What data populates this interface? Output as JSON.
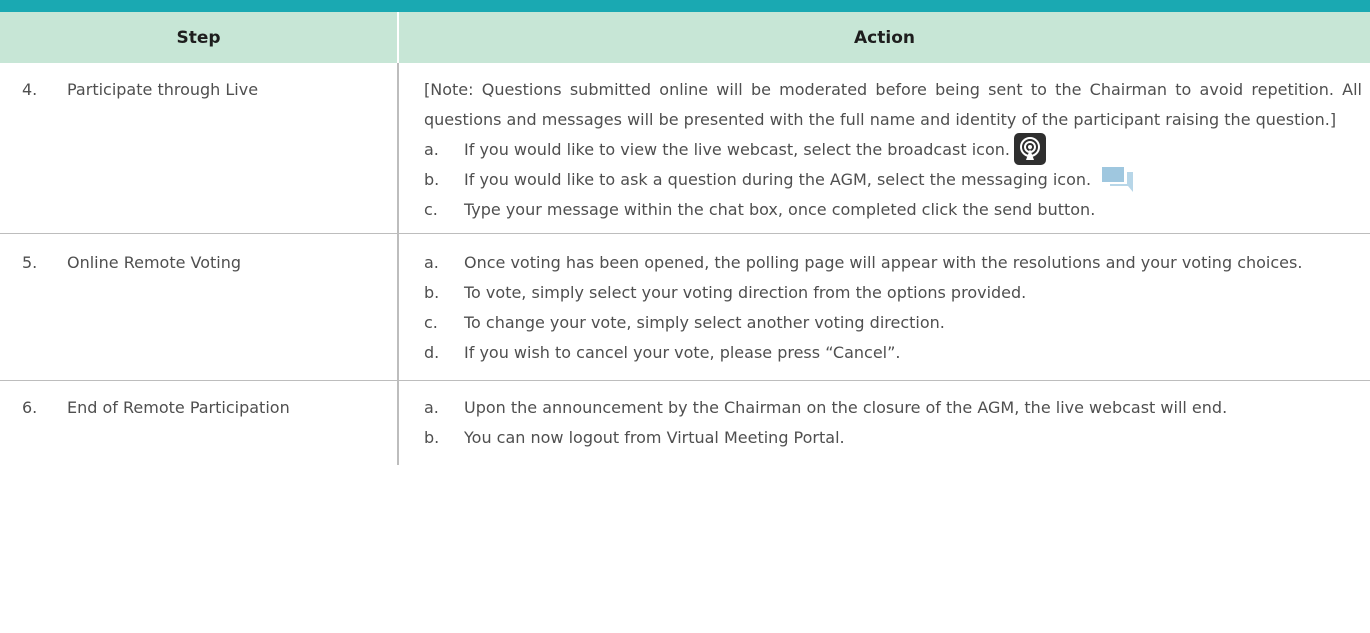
{
  "table": {
    "headers": {
      "step": "Step",
      "action": "Action"
    },
    "rows": [
      {
        "number": "4.",
        "step": "Participate through Live",
        "note": "[Note: Questions submitted online will be moderated before being sent to the Chairman to avoid repetition. All questions and messages will be presented with the full name and identity of the participant raising the question.]",
        "items": [
          {
            "letter": "a.",
            "text": "If you would like to view the live webcast, select the broadcast icon."
          },
          {
            "letter": "b.",
            "text": "If you would like to ask a question during the AGM, select the messaging icon."
          },
          {
            "letter": "c.",
            "text": "Type your message within the chat box, once completed click the send button."
          }
        ]
      },
      {
        "number": "5.",
        "step": "Online Remote Voting",
        "items": [
          {
            "letter": "a.",
            "text": "Once voting has been opened, the polling page will appear with the resolutions and your voting choices."
          },
          {
            "letter": "b.",
            "text": "To vote, simply select your voting direction from the options provided."
          },
          {
            "letter": "c.",
            "text": "To change your vote, simply select another voting direction."
          },
          {
            "letter": "d.",
            "text": "If you wish to cancel your vote, please press “Cancel”."
          }
        ]
      },
      {
        "number": "6.",
        "step": "End of Remote Participation",
        "items": [
          {
            "letter": "a.",
            "text": "Upon the announcement by the Chairman on the closure of the AGM, the live webcast will end."
          },
          {
            "letter": "b.",
            "text": "You can now logout from Virtual Meeting Portal."
          }
        ]
      }
    ]
  },
  "icons": {
    "broadcast": "broadcast-icon",
    "messaging": "messaging-icon"
  },
  "colors": {
    "top_bar": "#1aa9b2",
    "header_bg": "#c7e6d6"
  }
}
